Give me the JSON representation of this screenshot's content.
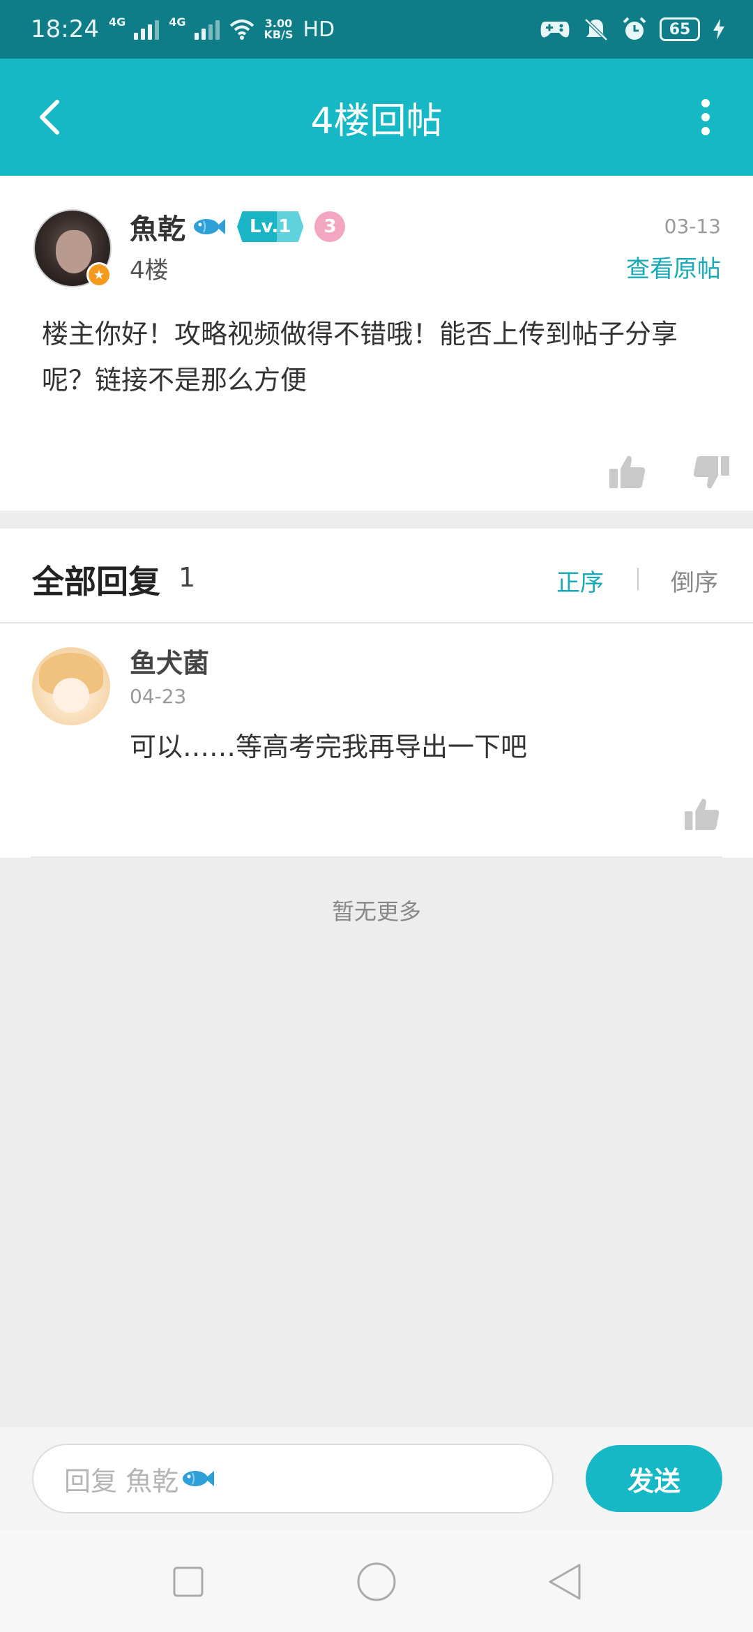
{
  "status_bar": {
    "time": "18:24",
    "network_1": "4G",
    "network_2": "4G",
    "speed_value": "3.00",
    "speed_unit": "KB/S",
    "hd": "HD",
    "battery": "65"
  },
  "app_bar": {
    "title": "4楼回帖"
  },
  "post": {
    "author": "魚乾",
    "level": "Lv.1",
    "pink_badge": "3",
    "floor": "4楼",
    "date": "03-13",
    "view_original": "查看原帖",
    "body": "楼主你好！攻略视频做得不错哦！能否上传到帖子分享呢？链接不是那么方便"
  },
  "replies": {
    "title": "全部回复",
    "count": "1",
    "sort_asc": "正序",
    "sort_desc": "倒序",
    "items": [
      {
        "name": "鱼犬菌",
        "date": "04-23",
        "body": "可以……等高考完我再导出一下吧"
      }
    ],
    "no_more": "暂无更多"
  },
  "input_bar": {
    "placeholder": "回复 魚乾",
    "send": "发送"
  },
  "colors": {
    "accent": "#16b8c6",
    "status_bar": "#0f7d87",
    "link": "#16aab9"
  }
}
